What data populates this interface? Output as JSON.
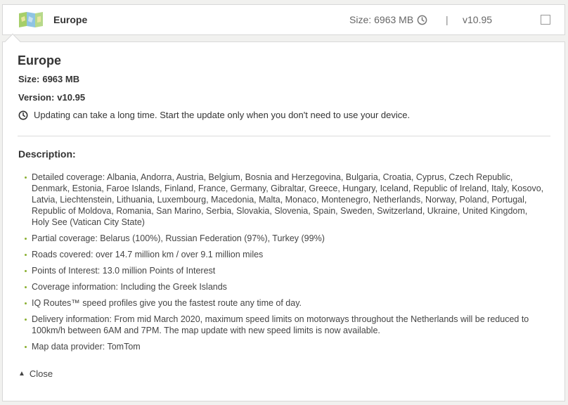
{
  "header": {
    "title": "Europe",
    "size_label": "Size:",
    "size_value": "6963 MB",
    "separator": "|",
    "version": "v10.95"
  },
  "panel": {
    "title": "Europe",
    "size_label": "Size:",
    "size_value": "6963 MB",
    "version_label": "Version:",
    "version_value": "v10.95",
    "warning": "Updating can take a long time. Start the update only when you don't need to use your device.",
    "description_title": "Description:",
    "items": [
      "Detailed coverage: Albania, Andorra, Austria, Belgium, Bosnia and Herzegovina, Bulgaria, Croatia, Cyprus, Czech Republic, Denmark, Estonia, Faroe Islands, Finland, France, Germany, Gibraltar, Greece, Hungary, Iceland, Republic of Ireland, Italy, Kosovo, Latvia, Liechtenstein, Lithuania, Luxembourg, Macedonia, Malta, Monaco, Montenegro, Netherlands, Norway, Poland, Portugal, Republic of Moldova, Romania, San Marino, Serbia, Slovakia, Slovenia, Spain, Sweden, Switzerland, Ukraine, United Kingdom, Holy See (Vatican City State)",
      "Partial coverage: Belarus (100%), Russian Federation (97%), Turkey (99%)",
      "Roads covered: over 14.7 million km / over 9.1 million miles",
      "Points of Interest: 13.0 million Points of Interest",
      "Coverage information: Including the Greek Islands",
      "IQ Routes™ speed profiles give you the fastest route any time of day.",
      "Delivery information: From mid March 2020, maximum speed limits on motorways throughout the Netherlands will be reduced to 100km/h between 6AM and 7PM. The map update with new speed limits is now available.",
      "Map data provider: TomTom"
    ],
    "close_label": "Close"
  },
  "icons": {
    "map": "map-icon",
    "clock": "clock-icon",
    "chevron": "chevron-up-icon"
  },
  "colors": {
    "bullet": "#8bb032",
    "map_green": "#a6cf6a",
    "map_blue": "#8fc4e3"
  }
}
